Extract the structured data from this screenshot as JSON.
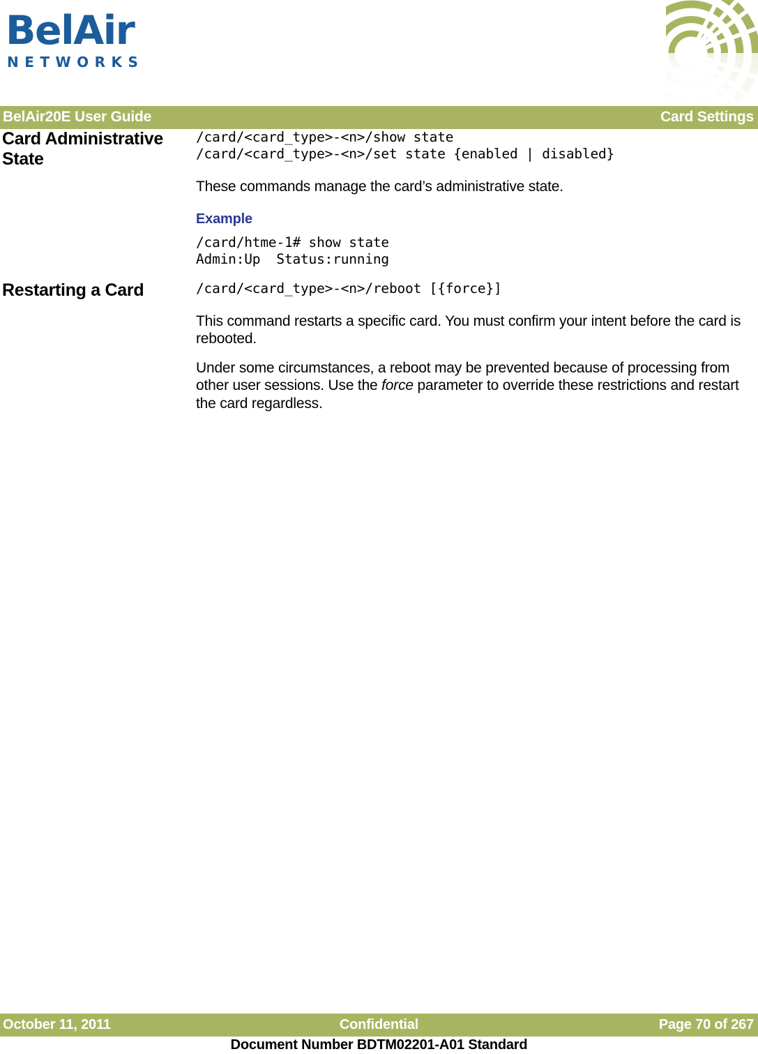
{
  "logo": {
    "wordmark": "BelAir",
    "subwordmark": "NETWORKS",
    "color": "#1b5c9b",
    "graphic_icon": "signal-waves-arc"
  },
  "header": {
    "left_title": "BelAir20E User Guide",
    "right_title": "Card Settings",
    "band_color": "#a9b461",
    "text_color": "#ffffff"
  },
  "sections": [
    {
      "heading": "Card Administrative State",
      "commands": "/card/<card_type>-<n>/show state\n/card/<card_type>-<n>/set state {enabled | disabled}",
      "description": "These commands manage the card’s administrative state.",
      "example_label": "Example",
      "example_code": "/card/htme-1# show state\nAdmin:Up  Status:running"
    },
    {
      "heading": "Restarting a Card",
      "commands": "/card/<card_type>-<n>/reboot [{force}]",
      "paragraph_1": "This command restarts a specific card. You must confirm your intent before the card is rebooted.",
      "paragraph_2_a": "Under some circumstances, a reboot may be prevented because of processing from other user sessions. Use the ",
      "paragraph_2_em": "force",
      "paragraph_2_b": " parameter to override these restrictions and restart the card regardless."
    }
  ],
  "footer": {
    "date": "October 11, 2011",
    "classification": "Confidential",
    "page": "Page 70 of 267",
    "document_number": "Document Number BDTM02201-A01 Standard",
    "band_color": "#a9b461"
  },
  "accent_colors": {
    "green_band": "#a9b461",
    "logo_blue": "#1b5c9b",
    "example_blue": "#2b3990"
  }
}
